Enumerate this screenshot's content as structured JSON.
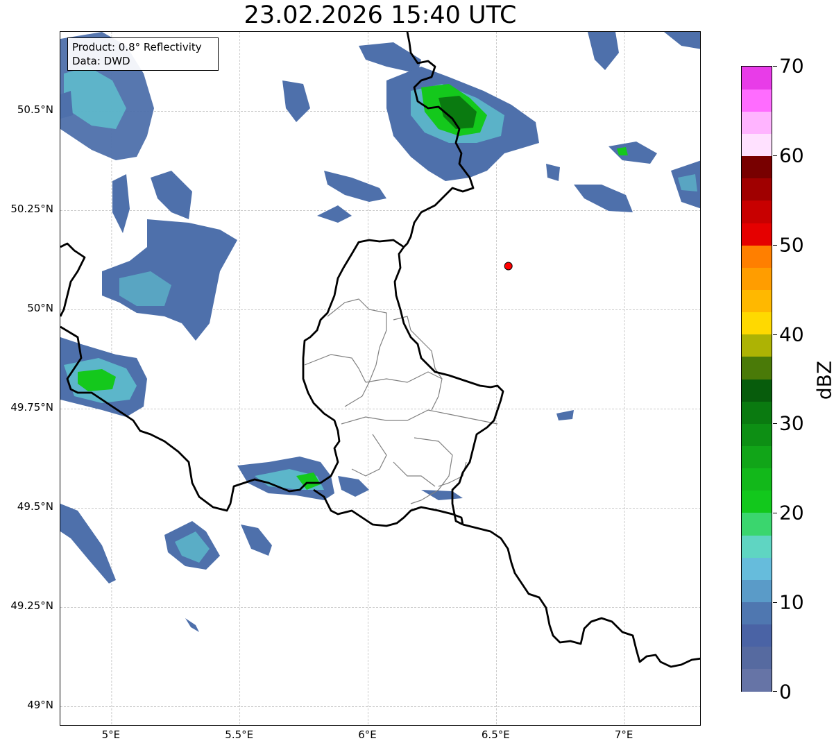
{
  "title": "23.02.2026 15:40 UTC",
  "info": {
    "line1": "Product: 0.8° Reflectivity",
    "line2": "Data: DWD"
  },
  "lat_labels": [
    "50.5°N",
    "50.25°N",
    "50°N",
    "49.75°N",
    "49.5°N",
    "49.25°N",
    "49°N"
  ],
  "lon_labels": [
    "5°E",
    "5.5°E",
    "6°E",
    "6.5°E",
    "7°E"
  ],
  "extent": {
    "lon_min": 4.8,
    "lon_max": 7.3,
    "lat_min": 48.95,
    "lat_max": 50.7
  },
  "colorbar": {
    "label": "dBZ",
    "ticks": [
      "0",
      "10",
      "20",
      "30",
      "40",
      "50",
      "60",
      "70"
    ],
    "colors": [
      "#6674a6",
      "#566aa0",
      "#4a63a5",
      "#4f77b0",
      "#5a9bc8",
      "#66bcdc",
      "#5fd5c2",
      "#3ad66e",
      "#12c81c",
      "#12b81a",
      "#11a518",
      "#0d8f14",
      "#0a7a10",
      "#075c0c",
      "#4a7a08",
      "#adb304",
      "#ffd900",
      "#ffb800",
      "#ff9d00",
      "#ff7f00",
      "#e50000",
      "#c80000",
      "#a00000",
      "#780000",
      "#ffe1ff",
      "#ffb4ff",
      "#ff6cff",
      "#e83ce8"
    ],
    "vmin": 0,
    "vmax": 70,
    "step": 2.5
  },
  "radar_site": {
    "lon": 6.547,
    "lat": 50.11,
    "color": "#ff0000"
  },
  "echo_colors": {
    "weak": "#4e70ab",
    "light": "#60c8d2",
    "moderate": "#14c81c",
    "strong": "#0a7a10"
  }
}
